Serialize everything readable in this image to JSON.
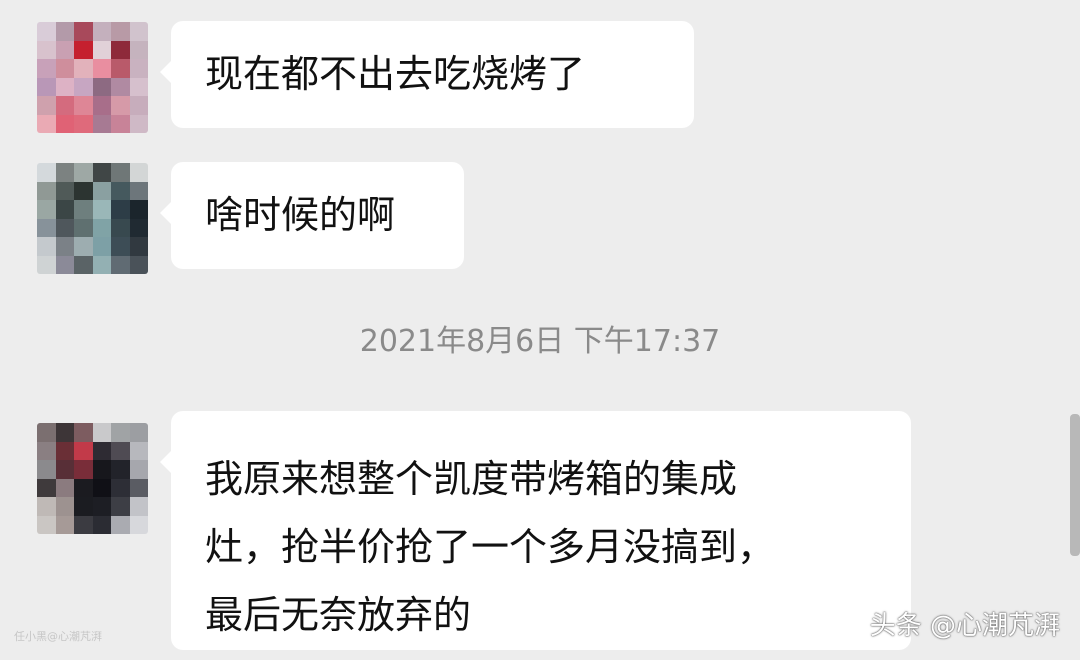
{
  "messages": [
    {
      "text": "现在都不出去吃烧烤了"
    },
    {
      "text": "啥时候的啊"
    },
    {
      "lines": [
        "我原来想整个凯度带烤箱的集成",
        "灶，抢半价抢了一个多月没搞到，",
        "最后无奈放弃的"
      ]
    }
  ],
  "timestamp": "2021年8月6日 下午17:37",
  "watermarks": {
    "left": "任小黑@心潮芃湃",
    "right": "头条 @心潮芃湃"
  },
  "colors": {
    "background": "#ededed",
    "bubble": "#ffffff",
    "timestamp": "#8a8a8a"
  },
  "avatars": {
    "a1": [
      "#d9ccd8",
      "#b39aa9",
      "#a8495b",
      "#c4b0bd",
      "#b89aa6",
      "#d1c3cd",
      "#d8c2cd",
      "#c9a0b2",
      "#c5202f",
      "#e1d1d8",
      "#8e2a3a",
      "#c5b3be",
      "#c8a1b9",
      "#cf8e9c",
      "#e2b2bb",
      "#e98ea0",
      "#b95a6a",
      "#c9b2c0",
      "#b997b7",
      "#ddb2c5",
      "#c7a6c2",
      "#8d6a82",
      "#b08aa2",
      "#d6c0cd",
      "#cfa1ad",
      "#d46b7e",
      "#de8696",
      "#a86e8a",
      "#d69aa8",
      "#c7adbc",
      "#eaaab4",
      "#e06275",
      "#df6a7b",
      "#a77a93",
      "#c88398",
      "#cfb9c6"
    ],
    "a2": [
      "#d4d9dc",
      "#7c8281",
      "#9ea8a5",
      "#404646",
      "#6f7777",
      "#d3d6d6",
      "#909995",
      "#505a58",
      "#2c3431",
      "#8aa0a1",
      "#45595e",
      "#6d767b",
      "#9aa7a3",
      "#3b4646",
      "#6e7f7e",
      "#9ab7b8",
      "#2d3d47",
      "#1b252c",
      "#87929a",
      "#4f575c",
      "#5f7070",
      "#80a3a6",
      "#38494f",
      "#202a32",
      "#c4c9cd",
      "#7b8187",
      "#9dadb0",
      "#7da0a6",
      "#3d4d56",
      "#313940",
      "#cfd3d4",
      "#8b8a98",
      "#5a6366",
      "#93b0b3",
      "#606b73",
      "#4a5259"
    ],
    "a3": [
      "#7b6f70",
      "#3d3537",
      "#7d5c60",
      "#c9c9cb",
      "#a0a3a5",
      "#9c9ea2",
      "#8a7f82",
      "#6a2f36",
      "#c23a49",
      "#2e2b33",
      "#4f4b53",
      "#b7b8bd",
      "#8b8a8d",
      "#582f37",
      "#792d39",
      "#17171c",
      "#22232a",
      "#a6a7ad",
      "#3f3a3c",
      "#8b7b7f",
      "#1b1b20",
      "#101016",
      "#2d2e36",
      "#5a5c63",
      "#bfb9b6",
      "#9d9290",
      "#1b1c21",
      "#1d1e24",
      "#3d3e45",
      "#c2c3c8",
      "#cac6c3",
      "#a69a97",
      "#3b3b41",
      "#2b2c33",
      "#aaabb1",
      "#d7d8dc"
    ]
  }
}
